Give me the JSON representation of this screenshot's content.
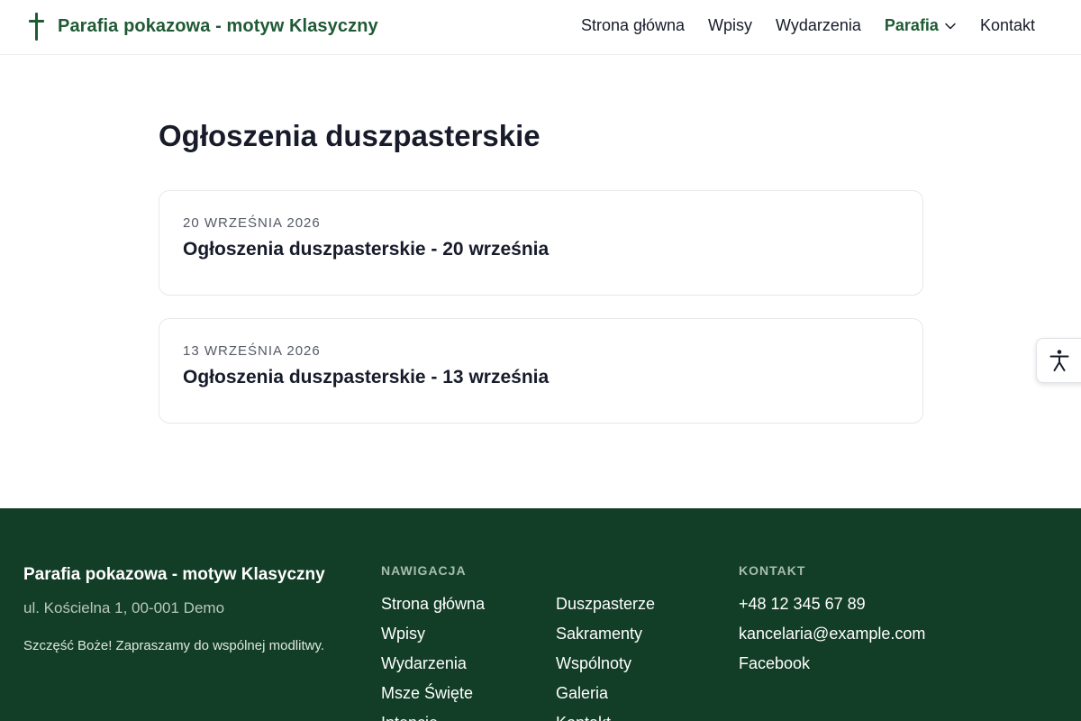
{
  "header": {
    "brand": "Parafia pokazowa - motyw Klasyczny",
    "nav": [
      {
        "label": "Strona główna"
      },
      {
        "label": "Wpisy"
      },
      {
        "label": "Wydarzenia"
      },
      {
        "label": "Parafia",
        "has_dropdown": true,
        "active": true
      },
      {
        "label": "Kontakt"
      }
    ]
  },
  "main": {
    "title": "Ogłoszenia duszpasterskie",
    "posts": [
      {
        "date": "20 WRZEŚNIA 2026",
        "title": "Ogłoszenia duszpasterskie - 20 września"
      },
      {
        "date": "13 WRZEŚNIA 2026",
        "title": "Ogłoszenia duszpasterskie - 13 września"
      }
    ]
  },
  "accessibility": {
    "icon": "accessibility-icon"
  },
  "footer": {
    "title": "Parafia pokazowa - motyw Klasyczny",
    "address": "ul. Kościelna 1, 00-001 Demo",
    "motto": "Szczęść Boże! Zapraszamy do wspólnej modlitwy.",
    "nav_heading": "NAWIGACJA",
    "nav_col1": [
      "Strona główna",
      "Wpisy",
      "Wydarzenia",
      "Msze Święte",
      "Intencje"
    ],
    "nav_col2": [
      "Duszpasterze",
      "Sakramenty",
      "Wspólnoty",
      "Galeria",
      "Kontakt"
    ],
    "contact_heading": "KONTAKT",
    "contact": [
      "+48 12 345 67 89",
      "kancelaria@example.com",
      "Facebook"
    ]
  },
  "colors": {
    "brand_green": "#1f5a35",
    "footer_bg": "#123d26",
    "text_dark": "#171b2a"
  }
}
